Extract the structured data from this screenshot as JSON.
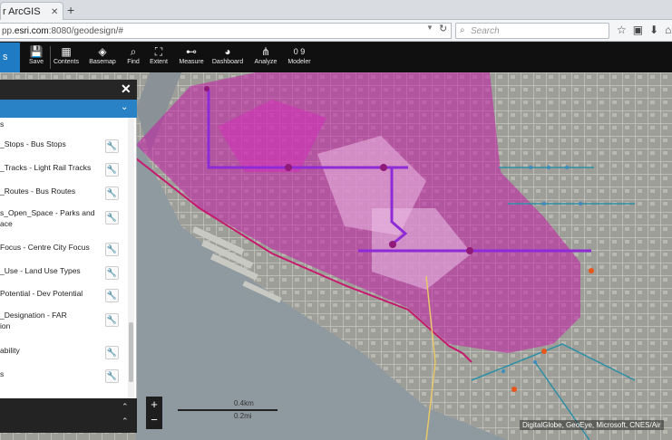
{
  "browser": {
    "tab_title": "r ArcGIS",
    "url_prefix": "pp.",
    "url_host": "esri.com",
    "url_rest": ":8080/geodesign/#",
    "search_placeholder": "Search"
  },
  "app": {
    "logo_text": "s",
    "toolbar": [
      {
        "label": "Save",
        "icon": "save-icon",
        "glyph": "💾"
      },
      {
        "label": "Contents",
        "icon": "grid-icon",
        "glyph": "▦"
      },
      {
        "label": "Basemap",
        "icon": "layers-icon",
        "glyph": "◈"
      },
      {
        "label": "Find",
        "icon": "search-icon",
        "glyph": "⌕"
      },
      {
        "label": "Extent",
        "icon": "extent-icon",
        "glyph": "⛶"
      },
      {
        "label": "Measure",
        "icon": "ruler-icon",
        "glyph": "⊷"
      },
      {
        "label": "Dashboard",
        "icon": "dashboard-icon",
        "glyph": "◕"
      },
      {
        "label": "Analyze",
        "icon": "analyze-icon",
        "glyph": "⋔"
      },
      {
        "label": "Modeler",
        "icon": "modeler-icon",
        "glyph": "0 9"
      }
    ]
  },
  "panel": {
    "close_glyph": "✕",
    "collapse_glyph": "⌄",
    "partial_header": "s",
    "layers": [
      {
        "line1": "_Stops - Bus Stops",
        "line2": ""
      },
      {
        "line1": "_Tracks - Light Rail Tracks",
        "line2": ""
      },
      {
        "line1": "_Routes - Bus Routes",
        "line2": ""
      },
      {
        "line1": "s_Open_Space - Parks and",
        "line2": "ace"
      },
      {
        "line1": "Focus - Centre City Focus",
        "line2": ""
      },
      {
        "line1": "_Use - Land Use Types",
        "line2": ""
      },
      {
        "line1": "Potential - Dev Potential",
        "line2": ""
      },
      {
        "line1": "_Designation - FAR",
        "line2": "ion"
      },
      {
        "line1": "ability",
        "line2": ""
      },
      {
        "line1": "s",
        "line2": ""
      }
    ]
  },
  "map": {
    "zoom_in": "+",
    "zoom_out": "−",
    "scale_km": "0.4km",
    "scale_mi": "0.2mi",
    "attribution": "DigitalGlobe, GeoEye, Microsoft, CNES/Air",
    "colors": {
      "overlay": "#c21ca6",
      "route": "#8f2bd6",
      "water": "#8f9aa0",
      "land": "#a9a9a4"
    }
  }
}
